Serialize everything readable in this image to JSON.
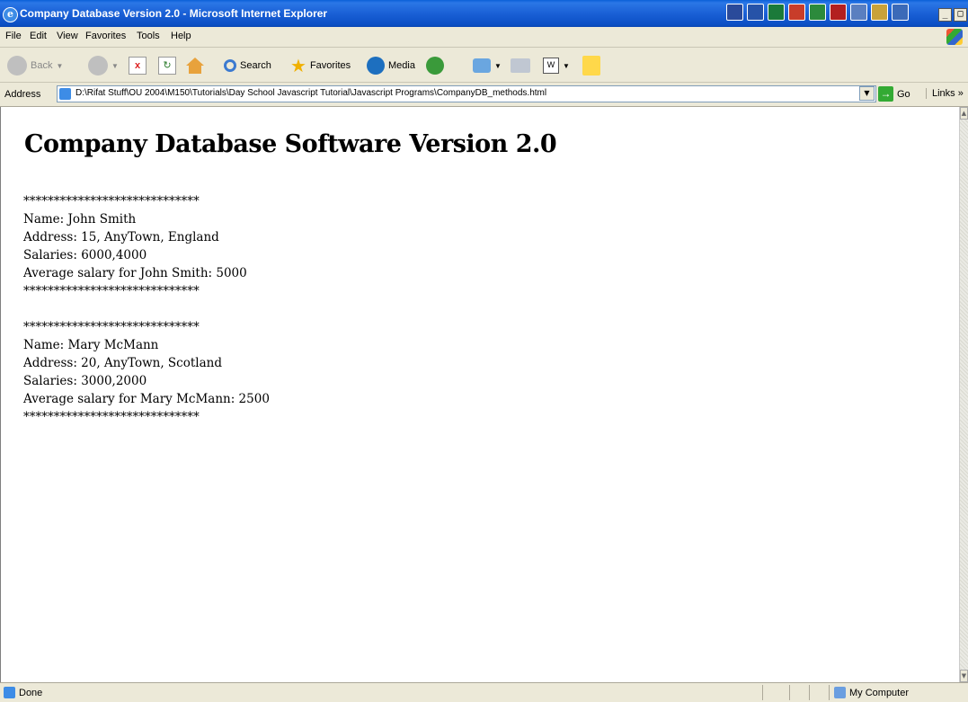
{
  "window": {
    "title": "Company Database Version 2.0 - Microsoft Internet Explorer",
    "controls": [
      "_",
      "□",
      "x"
    ]
  },
  "menu": {
    "items": [
      "File",
      "Edit",
      "View",
      "Favorites",
      "Tools",
      "Help"
    ]
  },
  "toolbar": {
    "back": "Back",
    "search": "Search",
    "favorites": "Favorites",
    "media": "Media"
  },
  "address": {
    "label": "Address",
    "url": "D:\\Rifat Stuff\\OU 2004\\M150\\Tutorials\\Day School Javascript Tutorial\\Javascript Programs\\CompanyDB_methods.html",
    "go": "Go",
    "links": "Links »"
  },
  "page": {
    "heading": "Company Database Software Version 2.0",
    "separator": "*****************************",
    "employees": [
      {
        "name": "Name: John Smith",
        "address": "Address: 15, AnyTown, England",
        "salaries": "Salaries: 6000,4000",
        "average": "Average salary for John Smith: 5000"
      },
      {
        "name": "Name: Mary McMann",
        "address": "Address: 20, AnyTown, Scotland",
        "salaries": "Salaries: 3000,2000",
        "average": "Average salary for Mary McMann: 2500"
      }
    ]
  },
  "status": {
    "text": "Done",
    "zone": "My Computer"
  },
  "colors": {
    "titlebar": "#0a5fd8",
    "chrome": "#ece9d8"
  }
}
